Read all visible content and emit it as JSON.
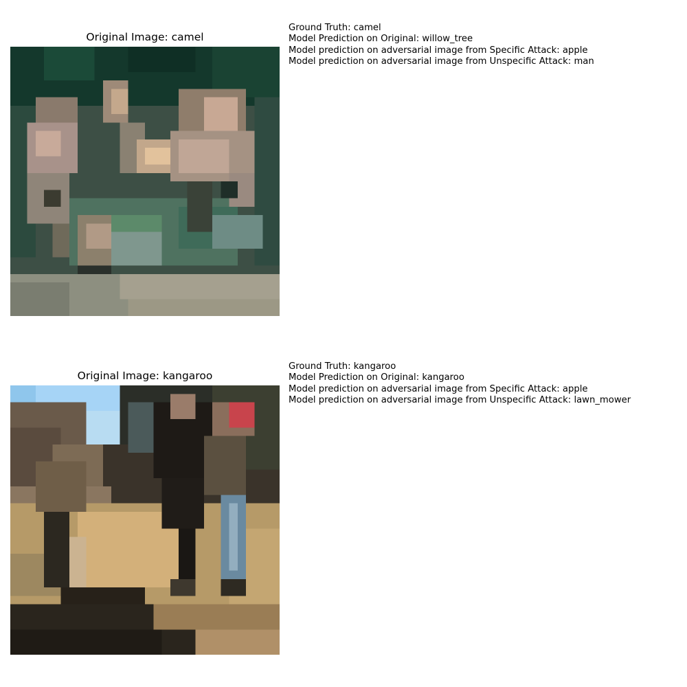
{
  "panels": [
    {
      "title": "Original Image: camel",
      "info": [
        "Ground Truth: camel",
        "Model Prediction on Original: willow_tree",
        "Model prediction on adversarial image from Specific Attack: apple",
        "Model prediction on adversarial image from Unspecific Attack: man"
      ]
    },
    {
      "title": "Original Image: kangaroo",
      "info": [
        "Ground Truth: kangaroo",
        "Model Prediction on Original: kangaroo",
        "Model prediction on adversarial image from Specific Attack: apple",
        "Model prediction on adversarial image from Unspecific Attack: lawn_mower"
      ]
    }
  ]
}
